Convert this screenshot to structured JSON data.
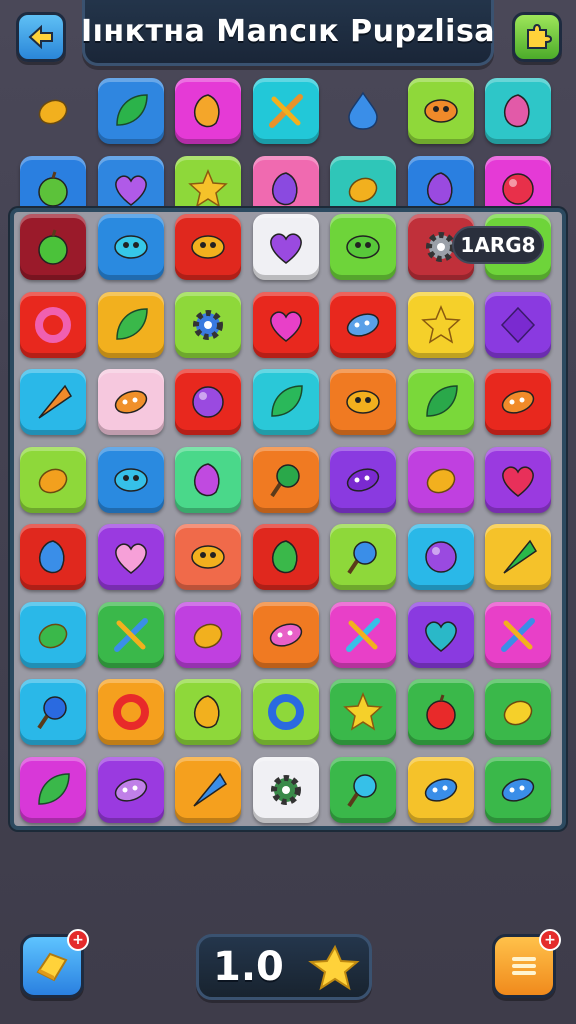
{
  "header": {
    "title": "Iıнктна Mancıк Pupzlisa",
    "back_icon": "left-arrow-icon",
    "help_icon": "puzzle-piece-icon"
  },
  "score": {
    "value": "1ARG8"
  },
  "footer": {
    "level_value": "1.0",
    "hint_badge": "+",
    "menu_badge": "+",
    "hint_icon": "gold-bar-icon",
    "menu_icon": "menu-lines-icon",
    "level_icon": "star-icon"
  },
  "palette": {
    "background": "#454351",
    "board": "#9a9aa4",
    "board_border": "#2c4a60",
    "title_panel": "#1f2e42"
  },
  "tray_rows": [
    [
      {
        "bg": "none",
        "icon": "lemon-icon",
        "color": "#f2b01e"
      },
      {
        "bg": "#2f86e0",
        "icon": "leaf-blob-icon",
        "color": "#2bb34a"
      },
      {
        "bg": "#e53ad6",
        "icon": "bird-icon",
        "color": "#f4a62a"
      },
      {
        "bg": "#22c8d8",
        "icon": "cross-sticks-icon",
        "color": "#e8922a"
      },
      {
        "bg": "none",
        "icon": "water-drop-icon",
        "color": "#3a8ee8"
      },
      {
        "bg": "#8fd83a",
        "icon": "fruit-face-icon",
        "color": "#f08a2a"
      },
      {
        "bg": "#2ec6c8",
        "icon": "mushroom-icon",
        "color": "#e25aa8"
      }
    ],
    [
      {
        "bg": "#2a7fe0",
        "icon": "apple-icon",
        "color": "#5cc23a"
      },
      {
        "bg": "#2f86e0",
        "icon": "heart-icon",
        "color": "#b05ae8"
      },
      {
        "bg": "#8ed83a",
        "icon": "star-icon",
        "color": "#f5c22a"
      },
      {
        "bg": "#f06ab0",
        "icon": "figure-icon",
        "color": "#8a4ae0"
      },
      {
        "bg": "#2fc6b8",
        "icon": "lemon-icon",
        "color": "#f2b01e"
      },
      {
        "bg": "#2a7fe0",
        "icon": "swirl-icon",
        "color": "#9a4ae0"
      },
      {
        "bg": "#e53ad6",
        "icon": "ball-icon",
        "color": "#e8304a"
      }
    ]
  ],
  "grid_rows": [
    [
      {
        "bg": "#9a1a2a",
        "icon": "apple-icon",
        "color": "#4bc23a"
      },
      {
        "bg": "#2a8ae0",
        "icon": "eye-icon",
        "color": "#36c7e8"
      },
      {
        "bg": "#e0281e",
        "icon": "lips-icon",
        "color": "#f2b01e"
      },
      {
        "bg": "#f0f0f4",
        "icon": "heart-icon",
        "color": "#9a4ae0"
      },
      {
        "bg": "#6ed43a",
        "icon": "frog-icon",
        "color": "#58c83a"
      },
      {
        "bg": "#c0303a",
        "icon": "gear-icon",
        "color": "#9aa0a8"
      },
      {
        "bg": "#6ed43a",
        "icon": "none",
        "color": "#6ed43a"
      }
    ],
    [
      {
        "bg": "#e8281e",
        "icon": "ring-icon",
        "color": "#f060b0"
      },
      {
        "bg": "#f2b01e",
        "icon": "leaf-icon",
        "color": "#3ab84a"
      },
      {
        "bg": "#8ed83a",
        "icon": "gear-icon",
        "color": "#3a7ae0"
      },
      {
        "bg": "#e8281e",
        "icon": "heart-icon",
        "color": "#e840c8"
      },
      {
        "bg": "#e8281e",
        "icon": "pod-icon",
        "color": "#5aa0e8"
      },
      {
        "bg": "#f5d02a",
        "icon": "star-icon",
        "color": "#f5d02a"
      },
      {
        "bg": "#8a3ae0",
        "icon": "diamond-icon",
        "color": "#7a2ad0"
      }
    ],
    [
      {
        "bg": "#2ab8e8",
        "icon": "carrot-icon",
        "color": "#f08a2a"
      },
      {
        "bg": "#f6c8de",
        "icon": "toast-icon",
        "color": "#f0902a"
      },
      {
        "bg": "#e8281e",
        "icon": "plum-icon",
        "color": "#9a4ae0"
      },
      {
        "bg": "#2ac8d8",
        "icon": "leaf-icon",
        "color": "#2ab85a"
      },
      {
        "bg": "#f07a22",
        "icon": "shell-icon",
        "color": "#f2b01e"
      },
      {
        "bg": "#7ad83a",
        "icon": "clover-icon",
        "color": "#2aa84a"
      },
      {
        "bg": "#e8281e",
        "icon": "bean-icon",
        "color": "#f08a2a"
      }
    ],
    [
      {
        "bg": "#8ed83a",
        "icon": "lemon-icon",
        "color": "#f2a01e"
      },
      {
        "bg": "#2a8ae0",
        "icon": "bug-icon",
        "color": "#36c0e8"
      },
      {
        "bg": "#4ad88a",
        "icon": "feather-icon",
        "color": "#c04ae0"
      },
      {
        "bg": "#f07a22",
        "icon": "lollipop-icon",
        "color": "#2aa84a"
      },
      {
        "bg": "#8a3ae0",
        "icon": "bean-icon",
        "color": "#7a2ad0"
      },
      {
        "bg": "#c040e0",
        "icon": "lemon-icon",
        "color": "#f2b01e"
      },
      {
        "bg": "#9a3ae0",
        "icon": "heart-icon",
        "color": "#e8305a"
      }
    ],
    [
      {
        "bg": "#e0281e",
        "icon": "hammer-icon",
        "color": "#3a8ee8"
      },
      {
        "bg": "#9a3ae0",
        "icon": "heart-icon",
        "color": "#f6a0d8"
      },
      {
        "bg": "#f06a4a",
        "icon": "shell-icon",
        "color": "#f2b01e"
      },
      {
        "bg": "#e0281e",
        "icon": "figure-icon",
        "color": "#3ab84a"
      },
      {
        "bg": "#8ed83a",
        "icon": "lollipop-icon",
        "color": "#3a8ee8"
      },
      {
        "bg": "#2ab8e8",
        "icon": "ball-icon",
        "color": "#9a4ae0"
      },
      {
        "bg": "#f5c22a",
        "icon": "wedge-icon",
        "color": "#2ab84a"
      }
    ],
    [
      {
        "bg": "#2ab8e8",
        "icon": "lime-icon",
        "color": "#3ab84a"
      },
      {
        "bg": "#3ab84a",
        "icon": "cross-sticks-icon",
        "color": "#3a8ee8"
      },
      {
        "bg": "#c040e0",
        "icon": "lemon-icon",
        "color": "#f2b01e"
      },
      {
        "bg": "#f07a22",
        "icon": "pod-icon",
        "color": "#e860c8"
      },
      {
        "bg": "#e840c8",
        "icon": "cross-sticks-icon",
        "color": "#36c0e8"
      },
      {
        "bg": "#8a3ae0",
        "icon": "heart-icon",
        "color": "#2ab8c8"
      },
      {
        "bg": "#e840c8",
        "icon": "pencil-icon",
        "color": "#3a8ee8"
      }
    ],
    [
      {
        "bg": "#2ab8e8",
        "icon": "mirror-icon",
        "color": "#2a6ae0"
      },
      {
        "bg": "#f5a01e",
        "icon": "ring-icon",
        "color": "#e82a2a"
      },
      {
        "bg": "#8ed83a",
        "icon": "flower-icon",
        "color": "#f2b01e"
      },
      {
        "bg": "#8ed83a",
        "icon": "donut-icon",
        "color": "#2a6ae0"
      },
      {
        "bg": "#3ab84a",
        "icon": "star-icon",
        "color": "#f5d02a"
      },
      {
        "bg": "#3ab84a",
        "icon": "apple-icon",
        "color": "#e82a2a"
      },
      {
        "bg": "#3ab84a",
        "icon": "lemon-icon",
        "color": "#f5d02a"
      }
    ],
    [
      {
        "bg": "#d838d8",
        "icon": "leaf-icon",
        "color": "#3ab84a"
      },
      {
        "bg": "#9a3ae0",
        "icon": "bean-icon",
        "color": "#c080e8"
      },
      {
        "bg": "#f5a01e",
        "icon": "arrow-icon",
        "color": "#3a8ee8"
      },
      {
        "bg": "#f0f0f4",
        "icon": "gear-icon",
        "color": "#3a8a4a"
      },
      {
        "bg": "#3ab84a",
        "icon": "lollipop-icon",
        "color": "#36c0e8"
      },
      {
        "bg": "#f5c22a",
        "icon": "bubble-icon",
        "color": "#3a8ee8"
      },
      {
        "bg": "#3ab84a",
        "icon": "pod-icon",
        "color": "#3a8ee8"
      }
    ]
  ]
}
